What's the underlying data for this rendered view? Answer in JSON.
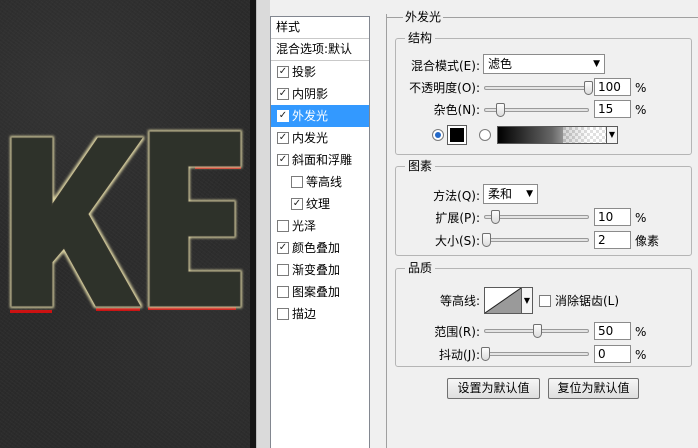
{
  "canvas_text": "KE",
  "style_list": {
    "header": "样式",
    "blend_options": "混合选项:默认",
    "items": [
      {
        "label": "投影",
        "checked": true,
        "selected": false,
        "level": 0
      },
      {
        "label": "内阴影",
        "checked": true,
        "selected": false,
        "level": 0
      },
      {
        "label": "外发光",
        "checked": true,
        "selected": true,
        "level": 0
      },
      {
        "label": "内发光",
        "checked": true,
        "selected": false,
        "level": 0
      },
      {
        "label": "斜面和浮雕",
        "checked": true,
        "selected": false,
        "level": 0
      },
      {
        "label": "等高线",
        "checked": false,
        "selected": false,
        "level": 1
      },
      {
        "label": "纹理",
        "checked": true,
        "selected": false,
        "level": 1
      },
      {
        "label": "光泽",
        "checked": false,
        "selected": false,
        "level": 0
      },
      {
        "label": "颜色叠加",
        "checked": true,
        "selected": false,
        "level": 0
      },
      {
        "label": "渐变叠加",
        "checked": false,
        "selected": false,
        "level": 0
      },
      {
        "label": "图案叠加",
        "checked": false,
        "selected": false,
        "level": 0
      },
      {
        "label": "描边",
        "checked": false,
        "selected": false,
        "level": 0
      }
    ]
  },
  "panel": {
    "title": "外发光",
    "structure": {
      "title": "结构",
      "blend_mode_label": "混合模式(E):",
      "blend_mode_value": "滤色",
      "opacity_label": "不透明度(O):",
      "opacity_value": "100",
      "opacity_fraction": 1.0,
      "noise_label": "杂色(N):",
      "noise_value": "15",
      "noise_fraction": 0.15,
      "percent": "%",
      "color_mode": "solid",
      "glow_color": "#000000"
    },
    "elements": {
      "title": "图素",
      "technique_label": "方法(Q):",
      "technique_value": "柔和",
      "spread_label": "扩展(P):",
      "spread_value": "10",
      "spread_fraction": 0.1,
      "size_label": "大小(S):",
      "size_value": "2",
      "size_fraction": 0.008,
      "percent": "%",
      "pixels": "像素"
    },
    "quality": {
      "title": "品质",
      "contour_label": "等高线:",
      "antialias_label": "消除锯齿(L)",
      "antialias_checked": false,
      "range_label": "范围(R):",
      "range_value": "50",
      "range_fraction": 0.5,
      "jitter_label": "抖动(J):",
      "jitter_value": "0",
      "jitter_fraction": 0.0,
      "percent": "%"
    },
    "buttons": {
      "make_default": "设置为默认值",
      "reset_default": "复位为默认值"
    }
  },
  "colors": {
    "selection": "#3399ff",
    "glow_edge": "#d8d0a0",
    "red_stroke": "#cc1111"
  }
}
